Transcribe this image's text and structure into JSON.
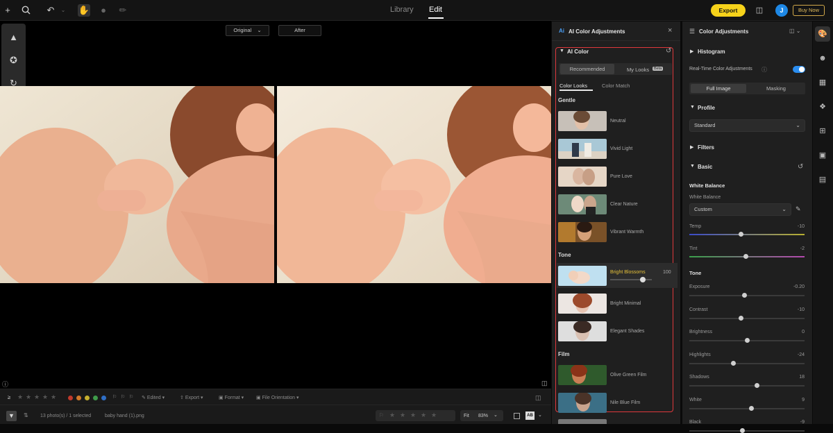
{
  "topbar": {
    "tab_library": "Library",
    "tab_edit": "Edit",
    "export_label": "Export",
    "avatar_initial": "J",
    "buy_now_label": "Buy Now"
  },
  "viewer": {
    "original_label": "Original",
    "after_label": "After"
  },
  "bottom_bar": {
    "edited_label": "Edited",
    "export_label": "Export",
    "format_label": "Format",
    "orientation_label": "File Orientation",
    "status_text": "13 photo(s) / 1 selected",
    "filename": "baby hand (1).png",
    "fit_label": "Fit",
    "zoom_value": "83%",
    "color_labels": [
      "#c0392b",
      "#d0792a",
      "#c6b02e",
      "#3f9b4a",
      "#2f6fc6"
    ]
  },
  "ai_panel": {
    "title": "AI Color Adjustments",
    "section_title": "AI Color",
    "tab_recommended": "Recommended",
    "tab_my_looks": "My Looks",
    "beta_badge": "Beta",
    "subtab_color_looks": "Color Looks",
    "subtab_color_match": "Color Match",
    "group_gentle": "Gentle",
    "group_tone": "Tone",
    "group_film": "Film",
    "gentle_looks": [
      "Neutral",
      "Vivid Light",
      "Pure Love",
      "Clear Nature",
      "Vibrant Warmth"
    ],
    "tone_looks": [
      "Bright Blossoms",
      "Bright Minimal",
      "Elegant Shades"
    ],
    "film_looks": [
      "Olive Green Film",
      "Nile Blue Film"
    ],
    "selected_intensity": "100"
  },
  "color_panel": {
    "title": "Color Adjustments",
    "histogram": "Histogram",
    "realtime_label": "Real-Time Color Adjustments",
    "realtime_on": true,
    "tab_full_image": "Full Image",
    "tab_masking": "Masking",
    "profile": "Profile",
    "profile_value": "Standard",
    "filters": "Filters",
    "basic": "Basic",
    "wb_heading": "White Balance",
    "wb_label": "White Balance",
    "wb_value": "Custom",
    "tone_heading": "Tone",
    "temp_label": "Temp",
    "temp_value": "-10",
    "tint_label": "Tint",
    "tint_value": "-2",
    "tone_sliders": [
      {
        "label": "Exposure",
        "value": "-0.20",
        "level": 0.48
      },
      {
        "label": "Contrast",
        "value": "-10",
        "level": 0.45
      },
      {
        "label": "Brightness",
        "value": "0",
        "level": 0.5
      },
      {
        "label": "Highlights",
        "value": "-24",
        "level": 0.38
      },
      {
        "label": "Shadows",
        "value": "18",
        "level": 0.59
      },
      {
        "label": "White",
        "value": "9",
        "level": 0.54
      },
      {
        "label": "Black",
        "value": "-9",
        "level": 0.46
      }
    ],
    "temp_level": 0.45,
    "tint_level": 0.49
  }
}
